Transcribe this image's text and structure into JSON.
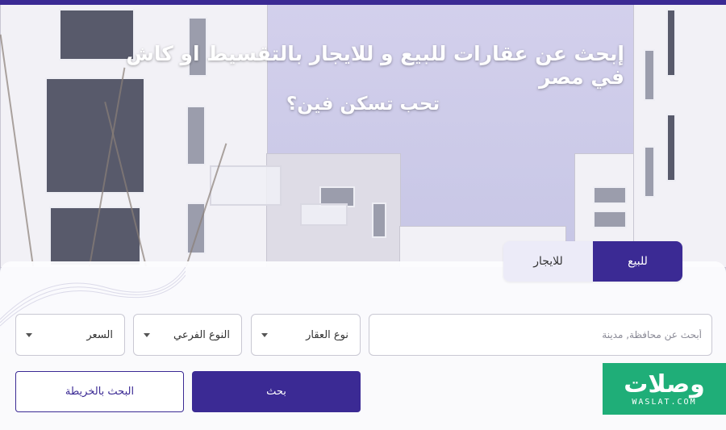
{
  "hero": {
    "title": "إبحث عن عقارات للبيع و للايجار بالتقسيط او كاش في مصر",
    "subtitle": "تحب تسكن فين؟"
  },
  "tabs": [
    {
      "label": "للايجار",
      "active": false
    },
    {
      "label": "للبيع",
      "active": true
    }
  ],
  "search": {
    "placeholder": "أبحث عن محافظة, مدينة",
    "property_type": "نوع العقار",
    "subtype": "النوع الفرعي",
    "price": "السعر",
    "search_button": "بحث",
    "map_button": "البحث بالخريطة"
  },
  "logo": {
    "arabic": "وصلات",
    "english": "WASLAT.COM"
  },
  "colors": {
    "brand": "#3b2a94",
    "logo_bg": "#1fae78"
  }
}
